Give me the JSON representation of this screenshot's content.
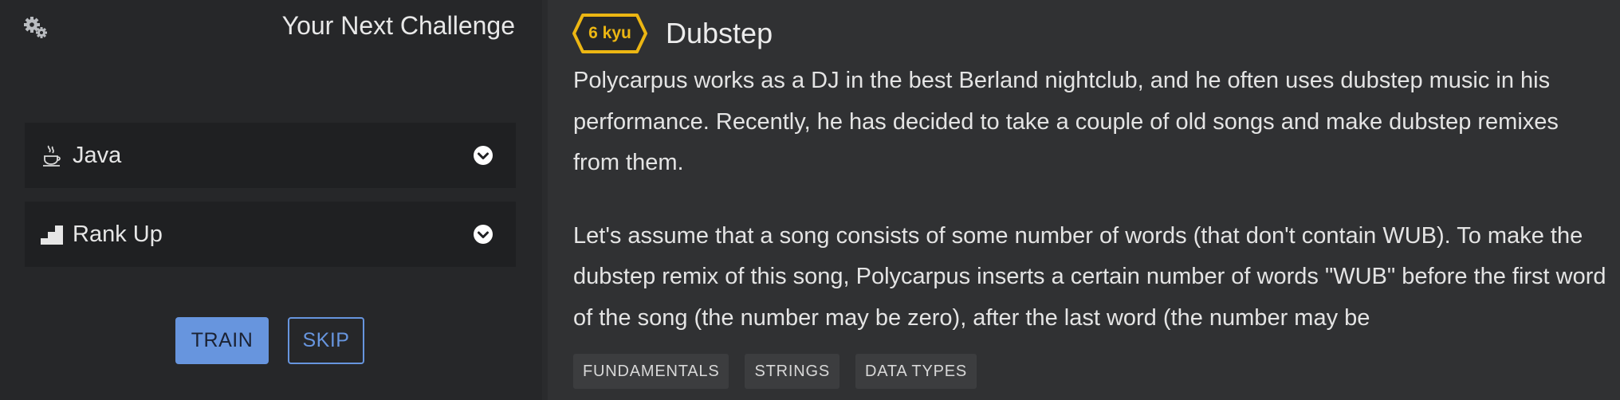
{
  "sidebar": {
    "title": "Your Next Challenge",
    "language_select": {
      "value": "Java",
      "icon": "java-icon"
    },
    "mode_select": {
      "value": "Rank Up",
      "icon": "stairs-icon"
    },
    "train_label": "TRAIN",
    "skip_label": "SKIP"
  },
  "kata": {
    "rank": "6 kyu",
    "title": "Dubstep",
    "paragraphs": [
      "Polycarpus works as a DJ in the best Berland nightclub, and he often uses dubstep music in his performance. Recently, he has decided to take a couple of old songs and make dubstep remixes from them.",
      "Let's assume that a song consists of some number of words (that don't contain WUB). To make the dubstep remix of this song, Polycarpus inserts a certain number of words \"WUB\" before the first word of the song (the number may be zero), after the last word (the number may be"
    ],
    "tags": [
      "FUNDAMENTALS",
      "STRINGS",
      "DATA TYPES"
    ]
  },
  "colors": {
    "accent": "#6795de",
    "rank": "#ecb613",
    "sidebar_bg": "#262729",
    "main_bg": "#303133"
  }
}
